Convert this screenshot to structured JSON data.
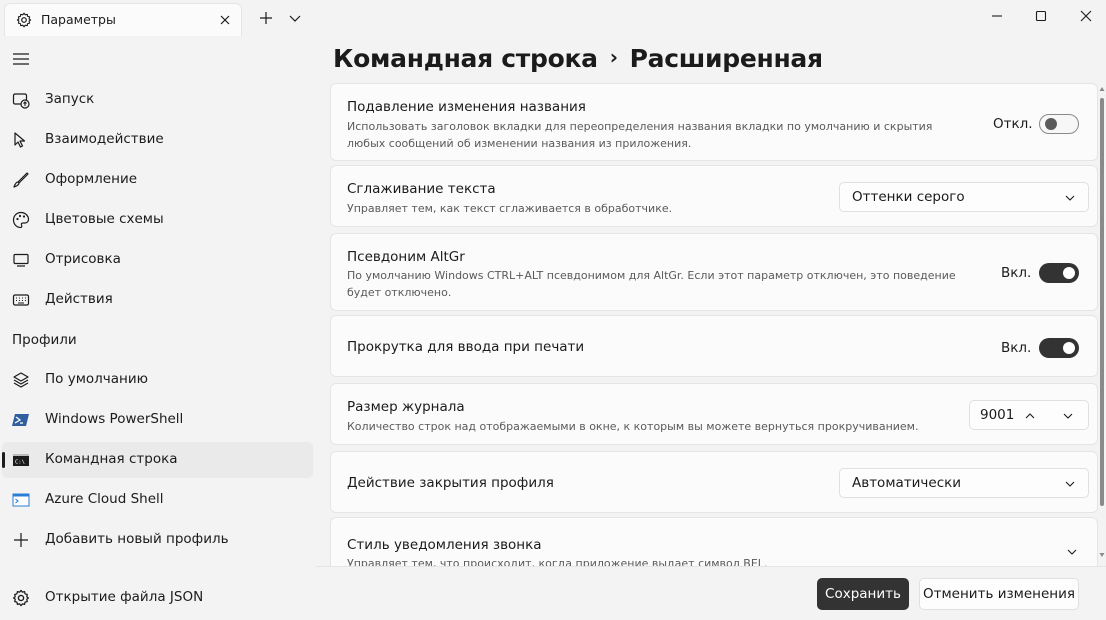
{
  "window": {
    "tab_title": "Параметры",
    "tab_icon": "gear-icon"
  },
  "sidebar": {
    "items": [
      {
        "label": "Запуск",
        "icon": "startup-icon"
      },
      {
        "label": "Взаимодействие",
        "icon": "pointer-icon"
      },
      {
        "label": "Оформление",
        "icon": "brush-icon"
      },
      {
        "label": "Цветовые схемы",
        "icon": "palette-icon"
      },
      {
        "label": "Отрисовка",
        "icon": "monitor-icon"
      },
      {
        "label": "Действия",
        "icon": "keyboard-icon"
      }
    ],
    "profiles_header": "Профили",
    "profiles": [
      {
        "label": "По умолчанию",
        "icon": "layers-icon"
      },
      {
        "label": "Windows PowerShell",
        "icon": "powershell-icon"
      },
      {
        "label": "Командная строка",
        "icon": "cmd-icon",
        "selected": true
      },
      {
        "label": "Azure Cloud Shell",
        "icon": "azure-icon"
      },
      {
        "label": "Добавить новый профиль",
        "icon": "plus-icon"
      }
    ],
    "open_json": "Открытие файла JSON"
  },
  "breadcrumb": {
    "parent": "Командная строка",
    "separator": "›",
    "current": "Расширенная"
  },
  "settings": {
    "suppress_title": {
      "title": "Подавление изменения названия",
      "description": "Использовать заголовок вкладки для переопределения названия вкладки по умолчанию и скрытия любых сообщений об изменении названия из приложения.",
      "state_label": "Откл.",
      "on": false
    },
    "antialiasing": {
      "title": "Сглаживание текста",
      "description": "Управляет тем, как текст сглаживается в обработчике.",
      "value": "Оттенки серого"
    },
    "altgr": {
      "title": "Псевдоним AltGr",
      "description": "По умолчанию Windows CTRL+ALT псевдонимом для AltGr. Если этот параметр отключен, это поведение будет отключено.",
      "state_label": "Вкл.",
      "on": true
    },
    "scroll_on_input": {
      "title": "Прокрутка для ввода при печати",
      "state_label": "Вкл.",
      "on": true
    },
    "history_size": {
      "title": "Размер журнала",
      "description": "Количество строк над отображаемыми в окне, к которым вы можете вернуться прокручиванием.",
      "value": "9001"
    },
    "close_action": {
      "title": "Действие закрытия профиля",
      "value": "Автоматически"
    },
    "bell_style": {
      "title": "Стиль уведомления звонка",
      "description": "Управляет тем, что происходит, когда приложение выдает символ BEL."
    }
  },
  "footer": {
    "save": "Сохранить",
    "discard": "Отменить изменения"
  }
}
